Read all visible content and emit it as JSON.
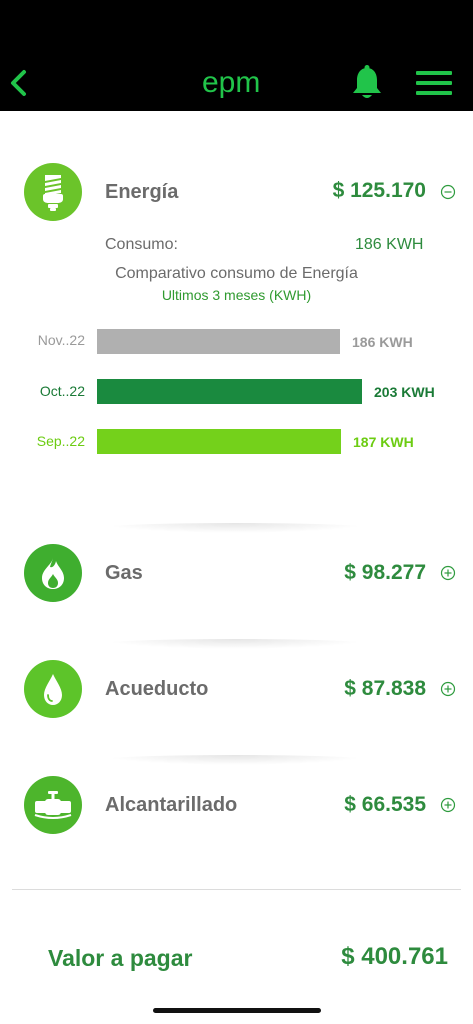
{
  "header": {
    "logo_text": "epm",
    "colors": {
      "background": "#000000",
      "accent": "#21c44a"
    },
    "icons": [
      "back-icon",
      "bell-icon",
      "menu-icon"
    ]
  },
  "services": [
    {
      "name": "Energía",
      "amount": "$ 125.170",
      "icon": "lightbulb-icon",
      "state": "expanded"
    },
    {
      "name": "Gas",
      "amount": "$ 98.277",
      "icon": "flame-icon",
      "state": "collapsed"
    },
    {
      "name": "Acueducto",
      "amount": "$ 87.838",
      "icon": "water-drop-icon",
      "state": "collapsed"
    },
    {
      "name": "Alcantarillado",
      "amount": "$ 66.535",
      "icon": "pipe-valve-icon",
      "state": "collapsed"
    }
  ],
  "energy_detail": {
    "consumo_label": "Consumo:",
    "consumo_value": "186 KWH",
    "chart_title": "Comparativo consumo de Energía",
    "chart_subtitle": "Ultimos 3 meses (KWH)"
  },
  "chart_data": {
    "type": "bar",
    "orientation": "horizontal",
    "title": "Comparativo consumo de Energía",
    "subtitle": "Ultimos 3 meses (KWH)",
    "categories": [
      "Nov..22",
      "Oct..22",
      "Sep..22"
    ],
    "values": [
      186,
      203,
      187
    ],
    "value_labels": [
      "186 KWH",
      "203 KWH",
      "187 KWH"
    ],
    "colors": [
      "#b0b0b0",
      "#1a8a3f",
      "#74d11b"
    ],
    "label_colors": [
      "#9a9a9a",
      "#1a7a36",
      "#6ccc12"
    ],
    "xlim": [
      0,
      203
    ]
  },
  "total": {
    "label": "Valor a pagar",
    "value": "$ 400.761"
  }
}
